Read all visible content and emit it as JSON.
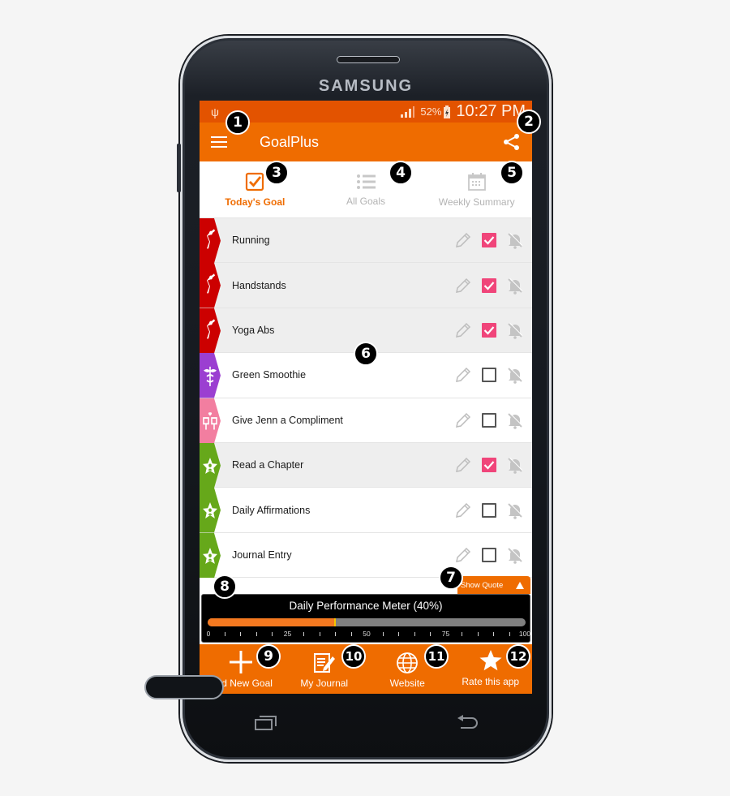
{
  "device": {
    "brand": "SAMSUNG"
  },
  "status_bar": {
    "battery": "52%",
    "time": "10:27 PM"
  },
  "app_bar": {
    "title": "GoalPlus",
    "menu_icon": "hamburger-icon",
    "share_icon": "share-icon"
  },
  "tabs": [
    {
      "label": "Today's Goal",
      "icon": "checkbox-icon",
      "active": true
    },
    {
      "label": "All Goals",
      "icon": "list-icon",
      "active": false
    },
    {
      "label": "Weekly Summary",
      "icon": "calendar-icon",
      "active": false
    }
  ],
  "goals": [
    {
      "name": "Running",
      "category_icon": "stretching-person-icon",
      "color": "#cc0000",
      "done": true
    },
    {
      "name": "Handstands",
      "category_icon": "stretching-person-icon",
      "color": "#cc0000",
      "done": true
    },
    {
      "name": "Yoga Abs",
      "category_icon": "stretching-person-icon",
      "color": "#cc0000",
      "done": true
    },
    {
      "name": "Green Smoothie",
      "category_icon": "caduceus-icon",
      "color": "#9b3fd1",
      "done": false
    },
    {
      "name": "Give Jenn a Compliment",
      "category_icon": "toasting-glasses-icon",
      "color": "#f27ea0",
      "done": false
    },
    {
      "name": "Read a Chapter",
      "category_icon": "star-person-icon",
      "color": "#66a81a",
      "done": true
    },
    {
      "name": "Daily Affirmations",
      "category_icon": "star-person-icon",
      "color": "#66a81a",
      "done": false
    },
    {
      "name": "Journal Entry",
      "category_icon": "star-person-icon",
      "color": "#66a81a",
      "done": false
    }
  ],
  "quote_button": {
    "label": "Show Quote",
    "icon": "triangle-up-icon"
  },
  "meter": {
    "title": "Daily Performance Meter  (40%)",
    "value_percent": 40,
    "tick_labels": [
      "0",
      "25",
      "50",
      "75",
      "100"
    ]
  },
  "bottom_nav": [
    {
      "label": "Add New Goal",
      "icon": "plus-icon"
    },
    {
      "label": "My Journal",
      "icon": "journal-pencil-icon"
    },
    {
      "label": "Website",
      "icon": "globe-icon"
    },
    {
      "label": "Rate this app",
      "icon": "star-icon"
    }
  ],
  "callouts": [
    "1",
    "2",
    "3",
    "4",
    "5",
    "6",
    "7",
    "8",
    "9",
    "10",
    "11",
    "12"
  ],
  "colors": {
    "primary": "#ef6c00",
    "status": "#e35300",
    "checked": "#f0457a"
  }
}
